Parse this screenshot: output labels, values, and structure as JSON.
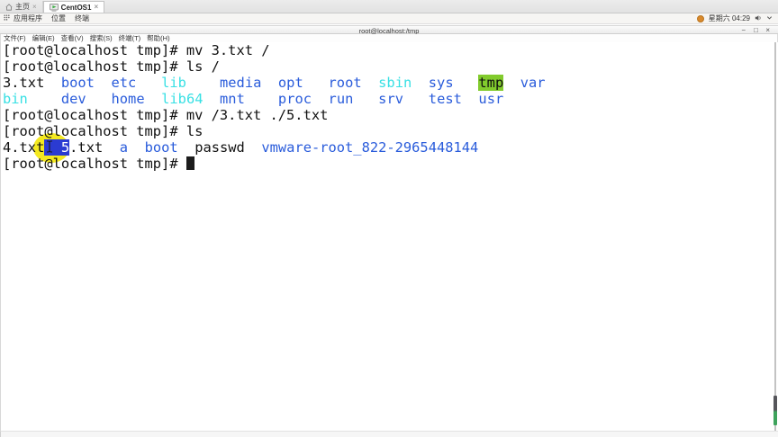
{
  "host_tabs": {
    "tabs": [
      {
        "label": "主页",
        "close": "×"
      },
      {
        "label": "CentOS1",
        "close": "×"
      }
    ]
  },
  "guest_panel": {
    "menu_items": [
      "应用程序",
      "位置",
      "终端"
    ],
    "clock": "星期六 04:29"
  },
  "terminal_window": {
    "title": "root@localhost:/tmp",
    "controls": {
      "minimize": "−",
      "maximize": "□",
      "close": "×"
    },
    "menu_items": [
      "文件(F)",
      "编辑(E)",
      "查看(V)",
      "搜索(S)",
      "终端(T)",
      "帮助(H)"
    ],
    "colors": {
      "text": "#111111",
      "directory_blue": "#2a5cdb",
      "symlink_cyan": "#38e0e4",
      "sticky_dir_green_bg": "#82cb2d",
      "selection_bg": "#2b3bd2",
      "selection_text": "#ffffff",
      "background": "#ffffff",
      "mouse_highlight_yellow": "#f3e70d",
      "scrollbar_green": "#3ea35c"
    },
    "lines": [
      {
        "segments": [
          {
            "t": "[root@localhost tmp]# mv 3.txt /",
            "c": "p"
          }
        ]
      },
      {
        "segments": [
          {
            "t": "[root@localhost tmp]# ls /",
            "c": "p"
          }
        ]
      },
      {
        "segments": [
          {
            "t": "3.txt  ",
            "c": "p"
          },
          {
            "t": "boot",
            "c": "d"
          },
          {
            "t": "  ",
            "c": "p"
          },
          {
            "t": "etc",
            "c": "d"
          },
          {
            "t": "   ",
            "c": "p"
          },
          {
            "t": "lib",
            "c": "s"
          },
          {
            "t": "    ",
            "c": "p"
          },
          {
            "t": "media",
            "c": "d"
          },
          {
            "t": "  ",
            "c": "p"
          },
          {
            "t": "opt",
            "c": "d"
          },
          {
            "t": "   ",
            "c": "p"
          },
          {
            "t": "root",
            "c": "d"
          },
          {
            "t": "  ",
            "c": "p"
          },
          {
            "t": "sbin",
            "c": "s"
          },
          {
            "t": "  ",
            "c": "p"
          },
          {
            "t": "sys",
            "c": "d"
          },
          {
            "t": "   ",
            "c": "p"
          },
          {
            "t": "tmp",
            "c": "t"
          },
          {
            "t": "  ",
            "c": "p"
          },
          {
            "t": "var",
            "c": "d"
          }
        ]
      },
      {
        "segments": [
          {
            "t": "bin",
            "c": "s"
          },
          {
            "t": "    ",
            "c": "p"
          },
          {
            "t": "dev",
            "c": "d"
          },
          {
            "t": "   ",
            "c": "p"
          },
          {
            "t": "home",
            "c": "d"
          },
          {
            "t": "  ",
            "c": "p"
          },
          {
            "t": "lib64",
            "c": "s"
          },
          {
            "t": "  ",
            "c": "p"
          },
          {
            "t": "mnt",
            "c": "d"
          },
          {
            "t": "    ",
            "c": "p"
          },
          {
            "t": "proc",
            "c": "d"
          },
          {
            "t": "  ",
            "c": "p"
          },
          {
            "t": "run",
            "c": "d"
          },
          {
            "t": "   ",
            "c": "p"
          },
          {
            "t": "srv",
            "c": "d"
          },
          {
            "t": "   ",
            "c": "p"
          },
          {
            "t": "test",
            "c": "d"
          },
          {
            "t": "  ",
            "c": "p"
          },
          {
            "t": "usr",
            "c": "d"
          }
        ]
      },
      {
        "segments": [
          {
            "t": "[root@localhost tmp]# mv /3.txt ./5.txt",
            "c": "p"
          }
        ]
      },
      {
        "segments": [
          {
            "t": "[root@localhost tmp]# ls",
            "c": "p"
          }
        ]
      },
      {
        "segments": [
          {
            "t": "4.txt",
            "c": "p"
          },
          {
            "t": "  5",
            "c": "sel"
          },
          {
            "t": ".txt  ",
            "c": "p"
          },
          {
            "t": "a",
            "c": "d"
          },
          {
            "t": "  ",
            "c": "p"
          },
          {
            "t": "boot",
            "c": "d"
          },
          {
            "t": "  ",
            "c": "p"
          },
          {
            "t": "passwd",
            "c": "p"
          },
          {
            "t": "  ",
            "c": "p"
          },
          {
            "t": "vmware-root_822-2965448144",
            "c": "d"
          }
        ]
      },
      {
        "segments": [
          {
            "t": "[root@localhost tmp]# ",
            "c": "p"
          },
          {
            "t": "",
            "c": "cur"
          }
        ]
      }
    ]
  }
}
